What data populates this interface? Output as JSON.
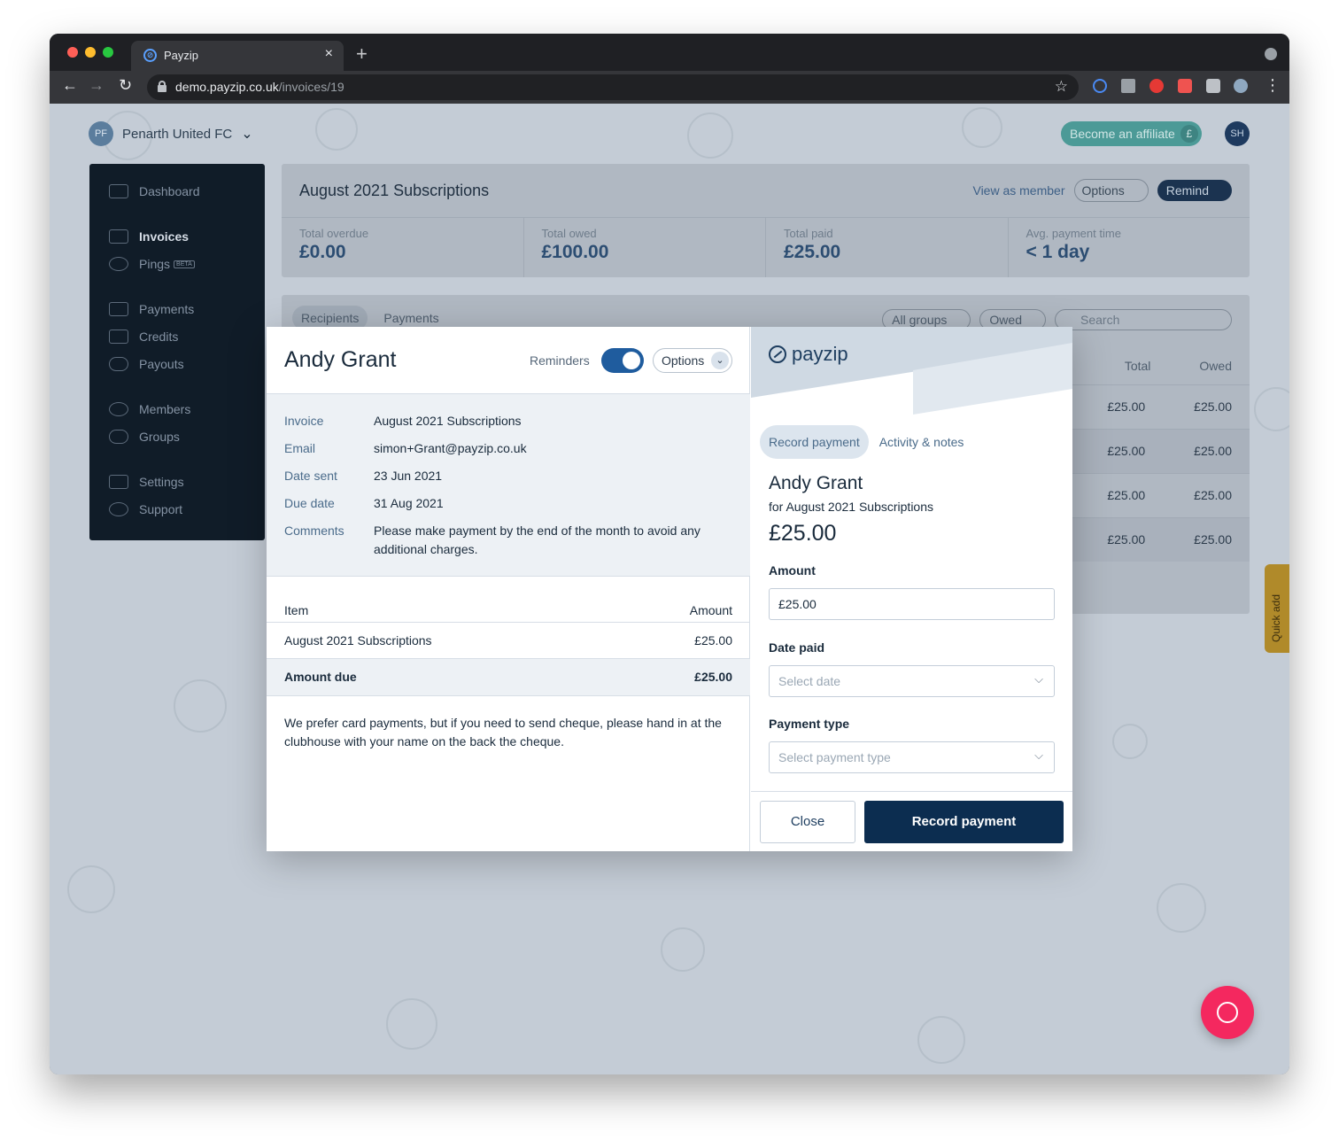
{
  "browser": {
    "tab_title": "Payzip",
    "tab_close": "×",
    "new_tab": "+",
    "url_host": "demo.payzip.co.uk",
    "url_path": "/invoices/19",
    "nav_back": "←",
    "nav_forward": "→",
    "nav_reload": "↻",
    "bookmark_star": "☆",
    "menu": "⋮"
  },
  "header": {
    "org_initials": "PF",
    "org_name": "Penarth United FC",
    "org_chevron": "⌄",
    "affiliate_label": "Become an affiliate",
    "affiliate_icon": "£",
    "user_initials": "SH"
  },
  "sidebar": {
    "items": [
      {
        "label": "Dashboard"
      },
      {
        "label": "Invoices"
      },
      {
        "label": "Pings",
        "badge": "BETA"
      },
      {
        "label": "Payments"
      },
      {
        "label": "Credits"
      },
      {
        "label": "Payouts"
      },
      {
        "label": "Members"
      },
      {
        "label": "Groups"
      },
      {
        "label": "Settings"
      },
      {
        "label": "Support"
      }
    ]
  },
  "invoice_panel": {
    "title": "August 2021 Subscriptions",
    "view_as_member": "View as member",
    "options": "Options",
    "remind": "Remind",
    "stats": [
      {
        "label": "Total overdue",
        "value": "£0.00"
      },
      {
        "label": "Total owed",
        "value": "£100.00"
      },
      {
        "label": "Total paid",
        "value": "£25.00"
      },
      {
        "label": "Avg. payment time",
        "value": "< 1 day"
      }
    ]
  },
  "list_panel": {
    "tabs": [
      "Recipients",
      "Payments"
    ],
    "filters": [
      "All groups",
      "Owed"
    ],
    "search_placeholder": "Search",
    "columns": [
      "Total",
      "Owed"
    ],
    "rows": [
      {
        "total": "£25.00",
        "owed": "£25.00"
      },
      {
        "total": "£25.00",
        "owed": "£25.00"
      },
      {
        "total": "£25.00",
        "owed": "£25.00"
      },
      {
        "total": "£25.00",
        "owed": "£25.00"
      }
    ]
  },
  "quick_add": "Quick add",
  "modal": {
    "name": "Andy Grant",
    "reminders_label": "Reminders",
    "reminders_on": true,
    "options": "Options",
    "chevron": "⌄",
    "details": [
      {
        "label": "Invoice",
        "value": "August 2021 Subscriptions"
      },
      {
        "label": "Email",
        "value": "simon+Grant@payzip.co.uk"
      },
      {
        "label": "Date sent",
        "value": "23 Jun 2021"
      },
      {
        "label": "Due date",
        "value": "31 Aug 2021"
      },
      {
        "label": "Comments",
        "value": "Please make payment by the end of the month to avoid any additional charges."
      }
    ],
    "items_header": {
      "item": "Item",
      "amount": "Amount"
    },
    "items": [
      {
        "item": "August 2021 Subscriptions",
        "amount": "£25.00"
      }
    ],
    "amount_due_label": "Amount due",
    "amount_due_value": "£25.00",
    "footnote": "We prefer card payments, but if you need to send cheque, please hand in at the clubhouse with your name on the back the cheque."
  },
  "record": {
    "brand": "payzip",
    "tabs": [
      "Record payment",
      "Activity & notes"
    ],
    "name": "Andy Grant",
    "for_text": "for August 2021 Subscriptions",
    "amount_display": "£25.00",
    "amount_label": "Amount",
    "amount_value": "£25.00",
    "date_label": "Date paid",
    "date_placeholder": "Select date",
    "type_label": "Payment type",
    "type_placeholder": "Select payment type",
    "close_button": "Close",
    "record_button": "Record payment"
  },
  "colors": {
    "brand_navy": "#0c2d50",
    "toggle_blue": "#1f5c9e",
    "chat_pink": "#f4285f",
    "affiliate_teal": "#4c9a97"
  }
}
